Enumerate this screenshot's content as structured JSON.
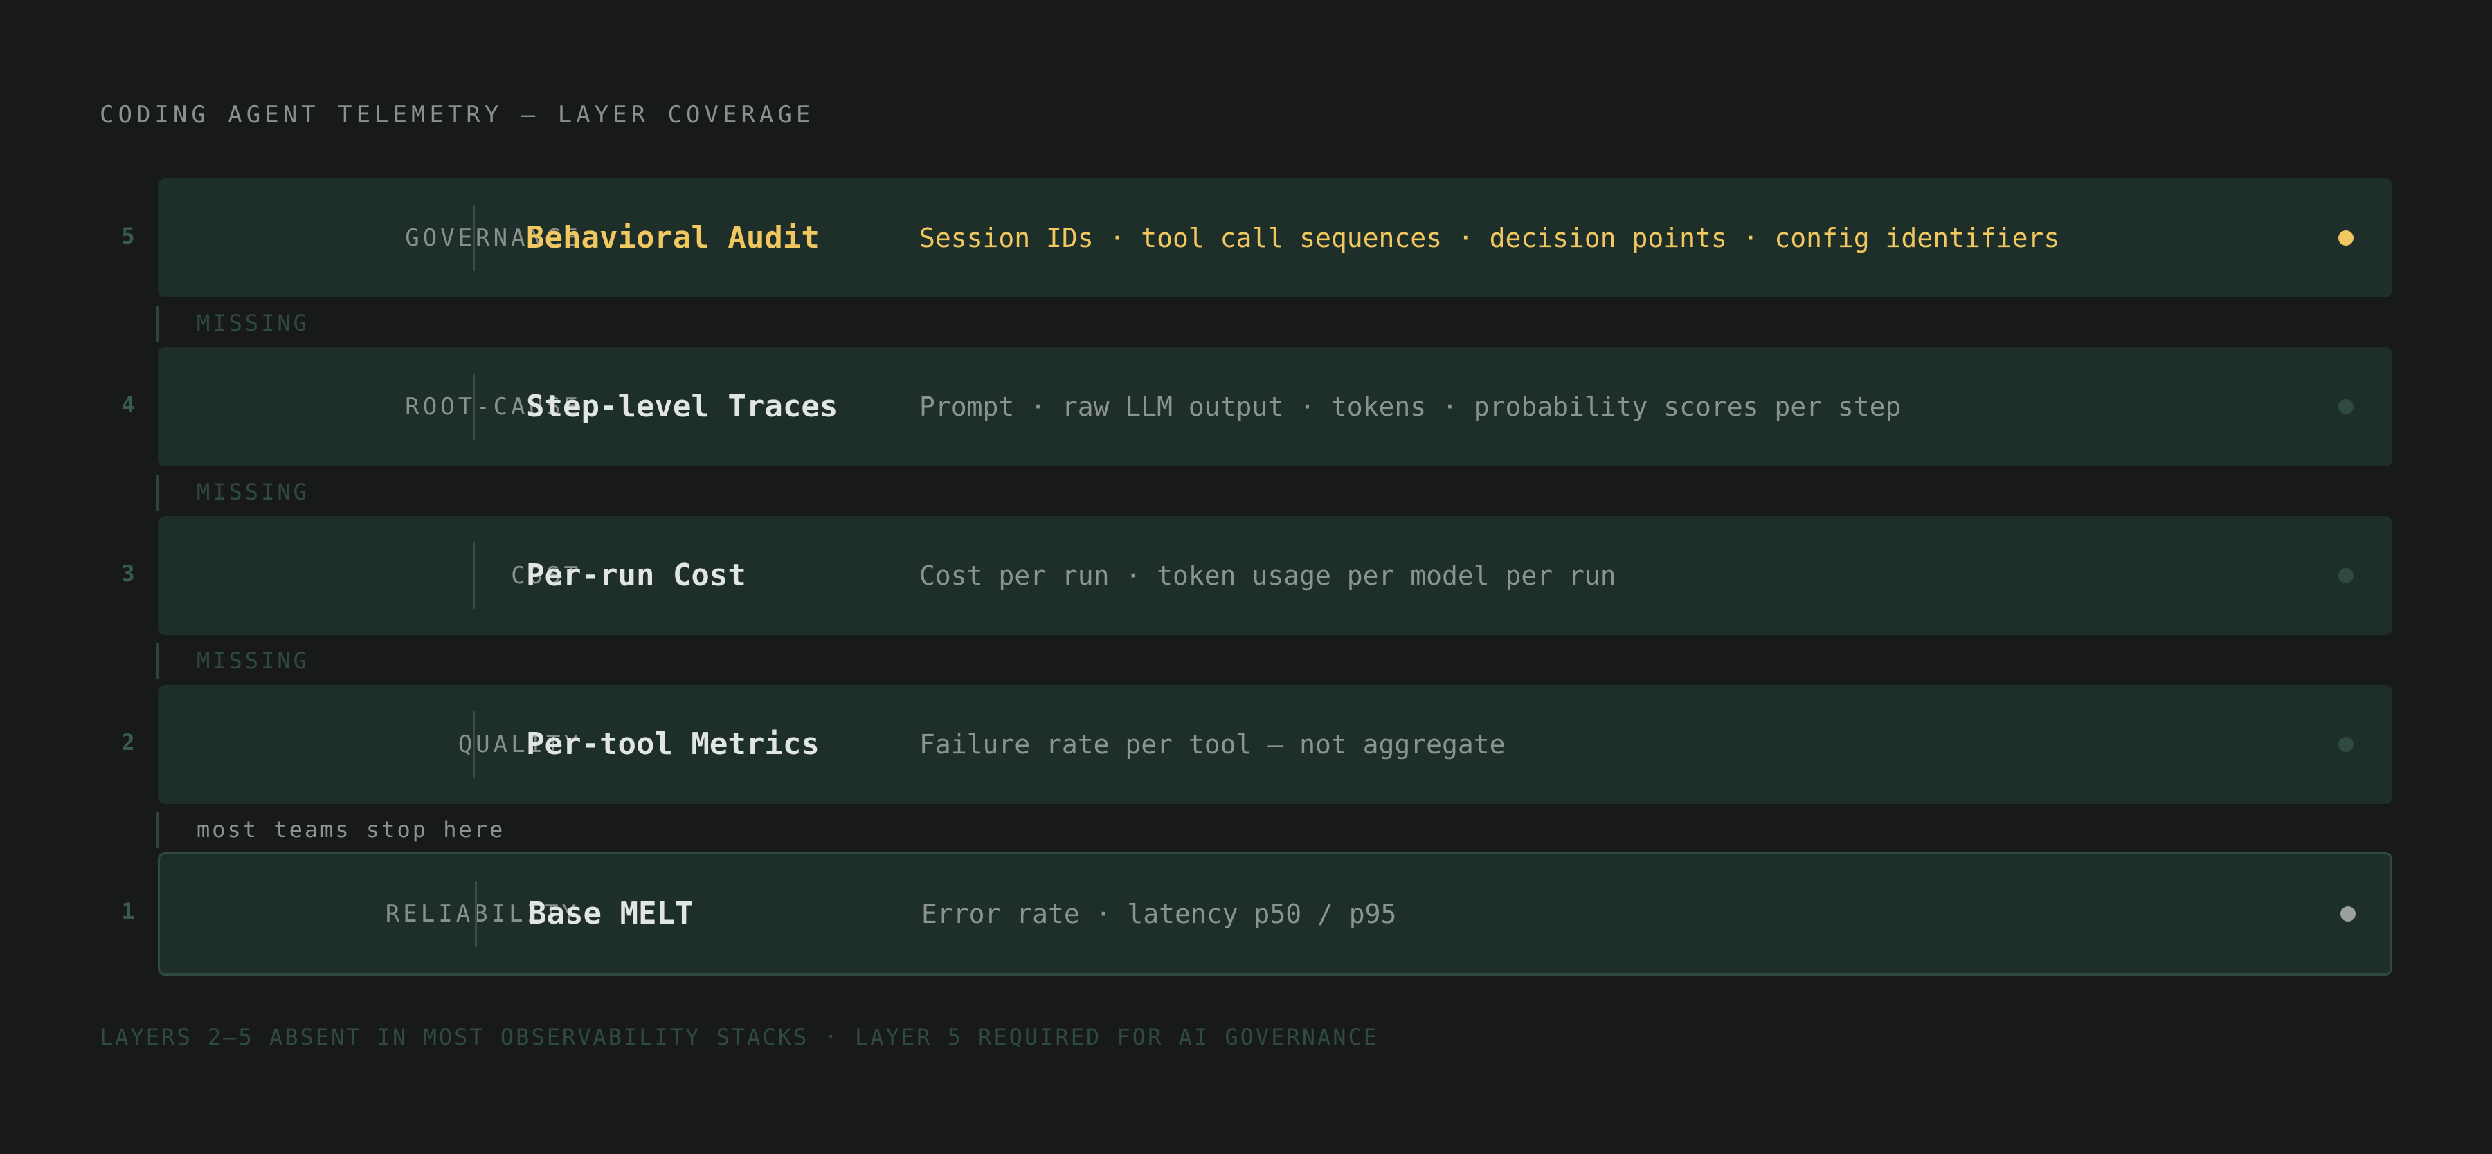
{
  "title": "CODING AGENT TELEMETRY — LAYER COVERAGE",
  "layers": [
    {
      "number": "5",
      "category": "GOVERNANCE",
      "name": "Behavioral Audit",
      "description": "Session IDs · tool call sequences · decision points · config identifiers",
      "status_color": "#f1c860"
    },
    {
      "number": "4",
      "category": "ROOT-CAUSE",
      "name": "Step-level Traces",
      "description": "Prompt · raw LLM output · tokens · probability scores per step",
      "status_color": "#2f4a3f"
    },
    {
      "number": "3",
      "category": "COST",
      "name": "Per-run Cost",
      "description": "Cost per run · token usage per model per run",
      "status_color": "#2f4a3f"
    },
    {
      "number": "2",
      "category": "QUALITY",
      "name": "Per-tool Metrics",
      "description": "Failure rate per tool — not aggregate",
      "status_color": "#2f4a3f"
    },
    {
      "number": "1",
      "category": "RELIABILITY",
      "name": "Base MELT",
      "description": "Error rate · latency p50 / p95",
      "status_color": "#9aa09c"
    }
  ],
  "gaps": [
    {
      "label": "MISSING"
    },
    {
      "label": "MISSING"
    },
    {
      "label": "MISSING"
    },
    {
      "label": "most teams stop here"
    }
  ],
  "footer": "LAYERS 2–5 ABSENT IN MOST OBSERVABILITY STACKS · LAYER 5 REQUIRED FOR AI GOVERNANCE",
  "colors": {
    "background": "#171a19",
    "card": "#1e2e29",
    "accent_gold": "#f1c860",
    "muted_green": "#2f4a3f"
  }
}
